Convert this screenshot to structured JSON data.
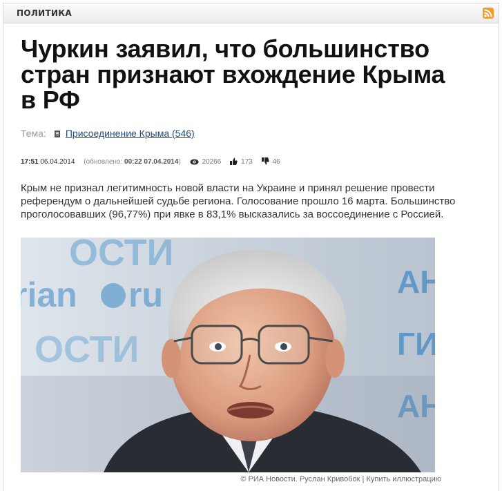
{
  "section": {
    "label": "ПОЛИТИКА",
    "rss_icon": "rss-icon"
  },
  "article": {
    "title": "Чуркин заявил, что большинство стран признают вхождение Крыма в РФ",
    "topic_label": "Тема:",
    "topic_link": "Присоединение Крыма (546)",
    "time": "17:51",
    "date": "06.04.2014",
    "updated_prefix": "(обновлено:",
    "updated_time": "00:22 07.04.2014",
    "updated_suffix": ")",
    "views": "20266",
    "likes": "173",
    "dislikes": "46",
    "lead": "Крым не признал легитимность новой власти на Украине и принял решение провести референдум о дальнейшей судьбе региона. Голосование прошло 16 марта. Большинство проголосовавших (96,77%) при явке в 83,1% высказались за воссоединение с Россией.",
    "photo_background_texts": [
      "ОСТИ",
      "rian",
      "ru",
      "ОСТИ",
      "АН",
      "ГИ",
      "АН"
    ],
    "photo_credit": "© РИА Новости. Руслан Кривобок",
    "photo_separator": " | ",
    "photo_buy": "Купить иллюстрацию"
  },
  "colors": {
    "accent_link": "#1c4f8c",
    "rss": "#f59a2a",
    "background_logo": "#4a90c8"
  }
}
